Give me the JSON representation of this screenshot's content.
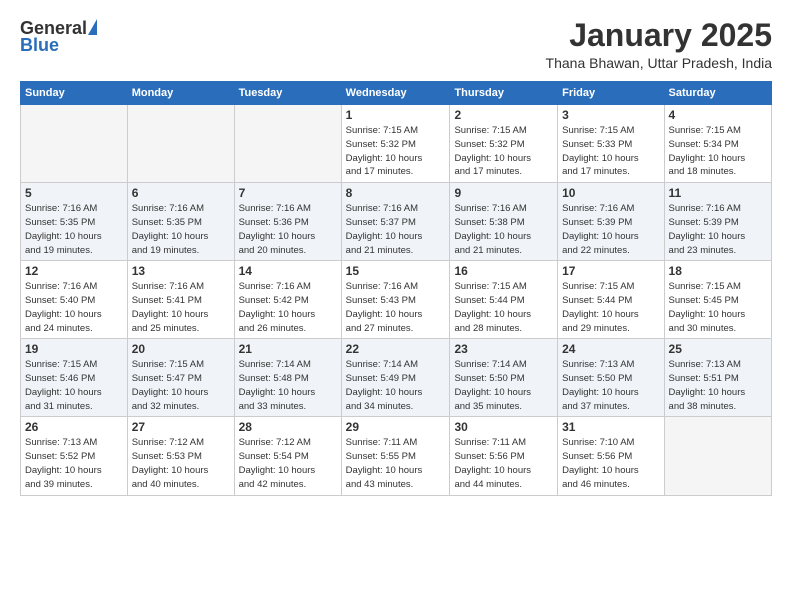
{
  "header": {
    "logo_general": "General",
    "logo_blue": "Blue",
    "month_title": "January 2025",
    "location": "Thana Bhawan, Uttar Pradesh, India"
  },
  "weekdays": [
    "Sunday",
    "Monday",
    "Tuesday",
    "Wednesday",
    "Thursday",
    "Friday",
    "Saturday"
  ],
  "weeks": [
    [
      {
        "day": "",
        "info": ""
      },
      {
        "day": "",
        "info": ""
      },
      {
        "day": "",
        "info": ""
      },
      {
        "day": "1",
        "info": "Sunrise: 7:15 AM\nSunset: 5:32 PM\nDaylight: 10 hours\nand 17 minutes."
      },
      {
        "day": "2",
        "info": "Sunrise: 7:15 AM\nSunset: 5:32 PM\nDaylight: 10 hours\nand 17 minutes."
      },
      {
        "day": "3",
        "info": "Sunrise: 7:15 AM\nSunset: 5:33 PM\nDaylight: 10 hours\nand 17 minutes."
      },
      {
        "day": "4",
        "info": "Sunrise: 7:15 AM\nSunset: 5:34 PM\nDaylight: 10 hours\nand 18 minutes."
      }
    ],
    [
      {
        "day": "5",
        "info": "Sunrise: 7:16 AM\nSunset: 5:35 PM\nDaylight: 10 hours\nand 19 minutes."
      },
      {
        "day": "6",
        "info": "Sunrise: 7:16 AM\nSunset: 5:35 PM\nDaylight: 10 hours\nand 19 minutes."
      },
      {
        "day": "7",
        "info": "Sunrise: 7:16 AM\nSunset: 5:36 PM\nDaylight: 10 hours\nand 20 minutes."
      },
      {
        "day": "8",
        "info": "Sunrise: 7:16 AM\nSunset: 5:37 PM\nDaylight: 10 hours\nand 21 minutes."
      },
      {
        "day": "9",
        "info": "Sunrise: 7:16 AM\nSunset: 5:38 PM\nDaylight: 10 hours\nand 21 minutes."
      },
      {
        "day": "10",
        "info": "Sunrise: 7:16 AM\nSunset: 5:39 PM\nDaylight: 10 hours\nand 22 minutes."
      },
      {
        "day": "11",
        "info": "Sunrise: 7:16 AM\nSunset: 5:39 PM\nDaylight: 10 hours\nand 23 minutes."
      }
    ],
    [
      {
        "day": "12",
        "info": "Sunrise: 7:16 AM\nSunset: 5:40 PM\nDaylight: 10 hours\nand 24 minutes."
      },
      {
        "day": "13",
        "info": "Sunrise: 7:16 AM\nSunset: 5:41 PM\nDaylight: 10 hours\nand 25 minutes."
      },
      {
        "day": "14",
        "info": "Sunrise: 7:16 AM\nSunset: 5:42 PM\nDaylight: 10 hours\nand 26 minutes."
      },
      {
        "day": "15",
        "info": "Sunrise: 7:16 AM\nSunset: 5:43 PM\nDaylight: 10 hours\nand 27 minutes."
      },
      {
        "day": "16",
        "info": "Sunrise: 7:15 AM\nSunset: 5:44 PM\nDaylight: 10 hours\nand 28 minutes."
      },
      {
        "day": "17",
        "info": "Sunrise: 7:15 AM\nSunset: 5:44 PM\nDaylight: 10 hours\nand 29 minutes."
      },
      {
        "day": "18",
        "info": "Sunrise: 7:15 AM\nSunset: 5:45 PM\nDaylight: 10 hours\nand 30 minutes."
      }
    ],
    [
      {
        "day": "19",
        "info": "Sunrise: 7:15 AM\nSunset: 5:46 PM\nDaylight: 10 hours\nand 31 minutes."
      },
      {
        "day": "20",
        "info": "Sunrise: 7:15 AM\nSunset: 5:47 PM\nDaylight: 10 hours\nand 32 minutes."
      },
      {
        "day": "21",
        "info": "Sunrise: 7:14 AM\nSunset: 5:48 PM\nDaylight: 10 hours\nand 33 minutes."
      },
      {
        "day": "22",
        "info": "Sunrise: 7:14 AM\nSunset: 5:49 PM\nDaylight: 10 hours\nand 34 minutes."
      },
      {
        "day": "23",
        "info": "Sunrise: 7:14 AM\nSunset: 5:50 PM\nDaylight: 10 hours\nand 35 minutes."
      },
      {
        "day": "24",
        "info": "Sunrise: 7:13 AM\nSunset: 5:50 PM\nDaylight: 10 hours\nand 37 minutes."
      },
      {
        "day": "25",
        "info": "Sunrise: 7:13 AM\nSunset: 5:51 PM\nDaylight: 10 hours\nand 38 minutes."
      }
    ],
    [
      {
        "day": "26",
        "info": "Sunrise: 7:13 AM\nSunset: 5:52 PM\nDaylight: 10 hours\nand 39 minutes."
      },
      {
        "day": "27",
        "info": "Sunrise: 7:12 AM\nSunset: 5:53 PM\nDaylight: 10 hours\nand 40 minutes."
      },
      {
        "day": "28",
        "info": "Sunrise: 7:12 AM\nSunset: 5:54 PM\nDaylight: 10 hours\nand 42 minutes."
      },
      {
        "day": "29",
        "info": "Sunrise: 7:11 AM\nSunset: 5:55 PM\nDaylight: 10 hours\nand 43 minutes."
      },
      {
        "day": "30",
        "info": "Sunrise: 7:11 AM\nSunset: 5:56 PM\nDaylight: 10 hours\nand 44 minutes."
      },
      {
        "day": "31",
        "info": "Sunrise: 7:10 AM\nSunset: 5:56 PM\nDaylight: 10 hours\nand 46 minutes."
      },
      {
        "day": "",
        "info": ""
      }
    ]
  ]
}
